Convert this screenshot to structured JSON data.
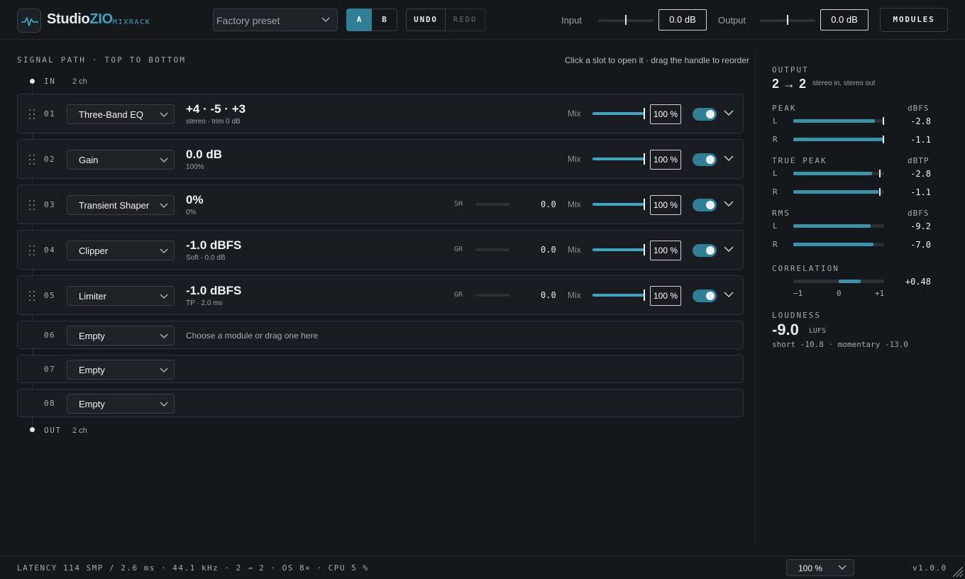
{
  "header": {
    "brand_name": "Studio",
    "brand_accent": "ZIO",
    "brand_sub": "MIXRACK",
    "preset": "Factory preset",
    "ab_a": "A",
    "ab_b": "B",
    "undo": "UNDO",
    "redo": "REDO",
    "input_label": "Input",
    "input_value": "0.0 dB",
    "input_level": 0.5,
    "output_label": "Output",
    "output_value": "0.0 dB",
    "output_level": 0.5,
    "modules": "MODULES"
  },
  "signal_path": {
    "title": "SIGNAL PATH · TOP TO BOTTOM",
    "hint": "Click a slot to open it · drag the handle to reorder",
    "in_label": "IN",
    "in_channels": "2 ch",
    "out_label": "OUT",
    "out_channels": "2 ch",
    "mix_label": "Mix",
    "empty_hint": "Choose a module or drag one here",
    "slots": [
      {
        "num": "01",
        "module": "Three-Band EQ",
        "value": "+4 · -5 · +3",
        "sub": "stereo · trim 0 dB",
        "meter_label": "",
        "meter_value": "",
        "mix": "100 %",
        "enabled": true
      },
      {
        "num": "02",
        "module": "Gain",
        "value": "0.0 dB",
        "sub": "100%",
        "meter_label": "",
        "meter_value": "",
        "mix": "100 %",
        "enabled": true
      },
      {
        "num": "03",
        "module": "Transient Shaper",
        "value": "0%",
        "sub": "0%",
        "meter_label": "SH",
        "meter_value": "0.0",
        "mix": "100 %",
        "enabled": true
      },
      {
        "num": "04",
        "module": "Clipper",
        "value": "-1.0 dBFS",
        "sub": "Soft · 0.0 dB",
        "meter_label": "GR",
        "meter_value": "0.0",
        "mix": "100 %",
        "enabled": true
      },
      {
        "num": "05",
        "module": "Limiter",
        "value": "-1.0 dBFS",
        "sub": "TP · 2.0 ms",
        "meter_label": "GR",
        "meter_value": "0.0",
        "mix": "100 %",
        "enabled": true
      },
      {
        "num": "06",
        "module": "Empty"
      },
      {
        "num": "07",
        "module": "Empty"
      },
      {
        "num": "08",
        "module": "Empty"
      }
    ]
  },
  "output_panel": {
    "title": "OUTPUT",
    "routing": "2 → 2",
    "routing_desc": "stereo in, stereo out",
    "peak": {
      "title": "PEAK",
      "unit": "dBFS",
      "L": "-2.8",
      "R": "-1.1",
      "L_level": 0.9,
      "R_level": 0.99
    },
    "true_peak": {
      "title": "TRUE PEAK",
      "unit": "dBTP",
      "L": "-2.8",
      "R": "-1.1",
      "L_level": 0.87,
      "R_level": 0.94
    },
    "rms": {
      "title": "RMS",
      "unit": "dBFS",
      "L": "-9.2",
      "R": "-7.0",
      "L_level": 0.85,
      "R_level": 0.88
    },
    "correlation": {
      "title": "CORRELATION",
      "value": "+0.48",
      "min": "−1",
      "mid": "0",
      "max": "+1",
      "level": 0.48
    },
    "loudness": {
      "title": "LOUDNESS",
      "value": "-9.0",
      "unit": "LUFS",
      "detail": "short -10.8 · momentary -13.0"
    }
  },
  "footer": {
    "status": "LATENCY 114 SMP / 2.6 ms · 44.1 kHz · 2 → 2 · OS 8× · CPU 5 %",
    "zoom": "100 %",
    "version": "v1.0.0"
  },
  "colors": {
    "accent": "#3ea3bd",
    "toggle_on": "#2f7f97",
    "background": "#15181b"
  }
}
